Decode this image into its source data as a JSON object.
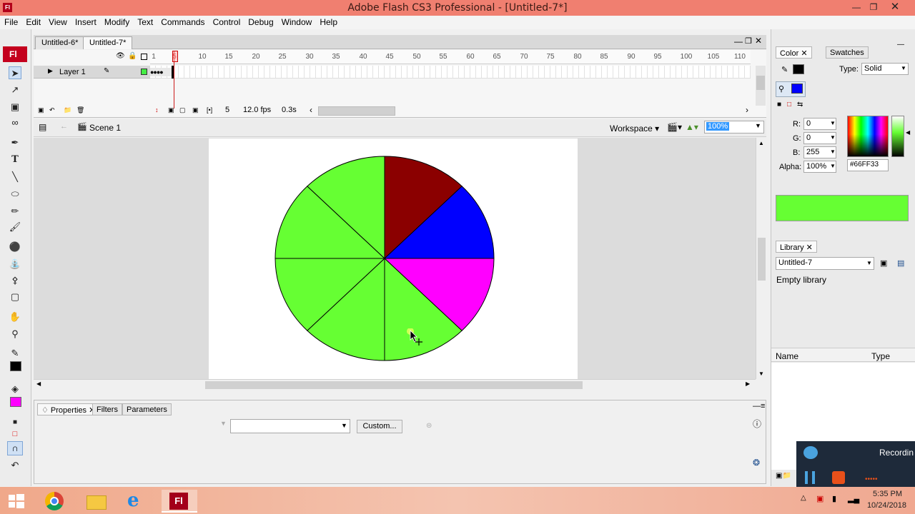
{
  "window": {
    "title": "Adobe Flash CS3 Professional - [Untitled-7*]",
    "app_badge": "Fl"
  },
  "menu": [
    "File",
    "Edit",
    "View",
    "Insert",
    "Modify",
    "Text",
    "Commands",
    "Control",
    "Debug",
    "Window",
    "Help"
  ],
  "doc_tabs": [
    "Untitled-6*",
    "Untitled-7*"
  ],
  "timeline": {
    "layer_name": "Layer 1",
    "ruler_ticks": [
      "1",
      "5",
      "10",
      "15",
      "20",
      "25",
      "30",
      "35",
      "40",
      "45",
      "50",
      "55",
      "60",
      "65",
      "70",
      "75",
      "80",
      "85",
      "90",
      "95",
      "100",
      "105",
      "110"
    ],
    "current_frame": "5",
    "fps": "12.0 fps",
    "time": "0.3s"
  },
  "editbar": {
    "scene": "Scene 1",
    "workspace": "Workspace",
    "zoom": "100%"
  },
  "pie": {
    "slices": [
      {
        "color": "#8b0000"
      },
      {
        "color": "#0000ff"
      },
      {
        "color": "#ff00ff"
      },
      {
        "color": "#66ff33"
      },
      {
        "color": "#66ff33"
      },
      {
        "color": "#66ff33"
      },
      {
        "color": "#66ff33"
      },
      {
        "color": "#66ff33"
      }
    ]
  },
  "properties": {
    "tabs": [
      "Properties",
      "Filters",
      "Parameters"
    ],
    "custom_button": "Custom..."
  },
  "color_panel": {
    "tabs": [
      "Color",
      "Swatches"
    ],
    "type_label": "Type:",
    "type_value": "Solid",
    "r_label": "R:",
    "r": "0",
    "g_label": "G:",
    "g": "0",
    "b_label": "B:",
    "b": "255",
    "alpha_label": "Alpha:",
    "alpha": "100%",
    "hex": "#66FF33",
    "preview_color": "#66ff33"
  },
  "library": {
    "tab": "Library",
    "doc": "Untitled-7",
    "status": "Empty library",
    "col_name": "Name",
    "col_type": "Type"
  },
  "recorder": {
    "label": "Recordin"
  },
  "taskbar": {
    "time": "5:35 PM",
    "date": "10/24/2018"
  }
}
